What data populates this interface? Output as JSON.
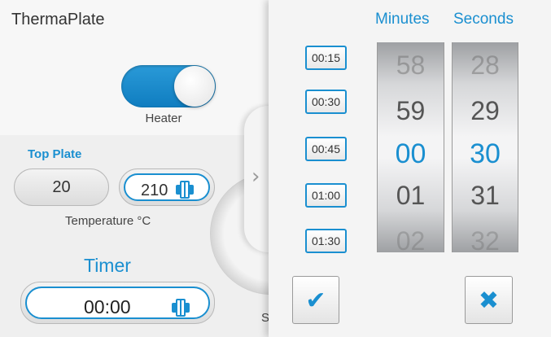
{
  "app": {
    "title": "ThermaPlate"
  },
  "heater": {
    "label": "Heater",
    "on": true
  },
  "plate": {
    "section_label": "Top Plate",
    "actual_temperature": "20",
    "set_temperature": "210",
    "units_label": "Temperature °C"
  },
  "timer": {
    "label": "Timer",
    "value": "00:00"
  },
  "dial": {
    "partial_label": "S"
  },
  "popup": {
    "expand_icon": "chevron-right-icon",
    "presets": [
      "00:15",
      "00:30",
      "00:45",
      "01:00",
      "01:30"
    ],
    "minutes": {
      "header": "Minutes",
      "values": [
        "58",
        "59",
        "00",
        "01",
        "02"
      ],
      "selected": "00"
    },
    "seconds": {
      "header": "Seconds",
      "values": [
        "28",
        "29",
        "30",
        "31",
        "32"
      ],
      "selected": "30"
    },
    "confirm_icon": "checkmark-icon",
    "cancel_icon": "close-icon"
  },
  "colors": {
    "accent": "#1a8fd0",
    "panel": "#f4f4f4",
    "background": "#efefef"
  }
}
